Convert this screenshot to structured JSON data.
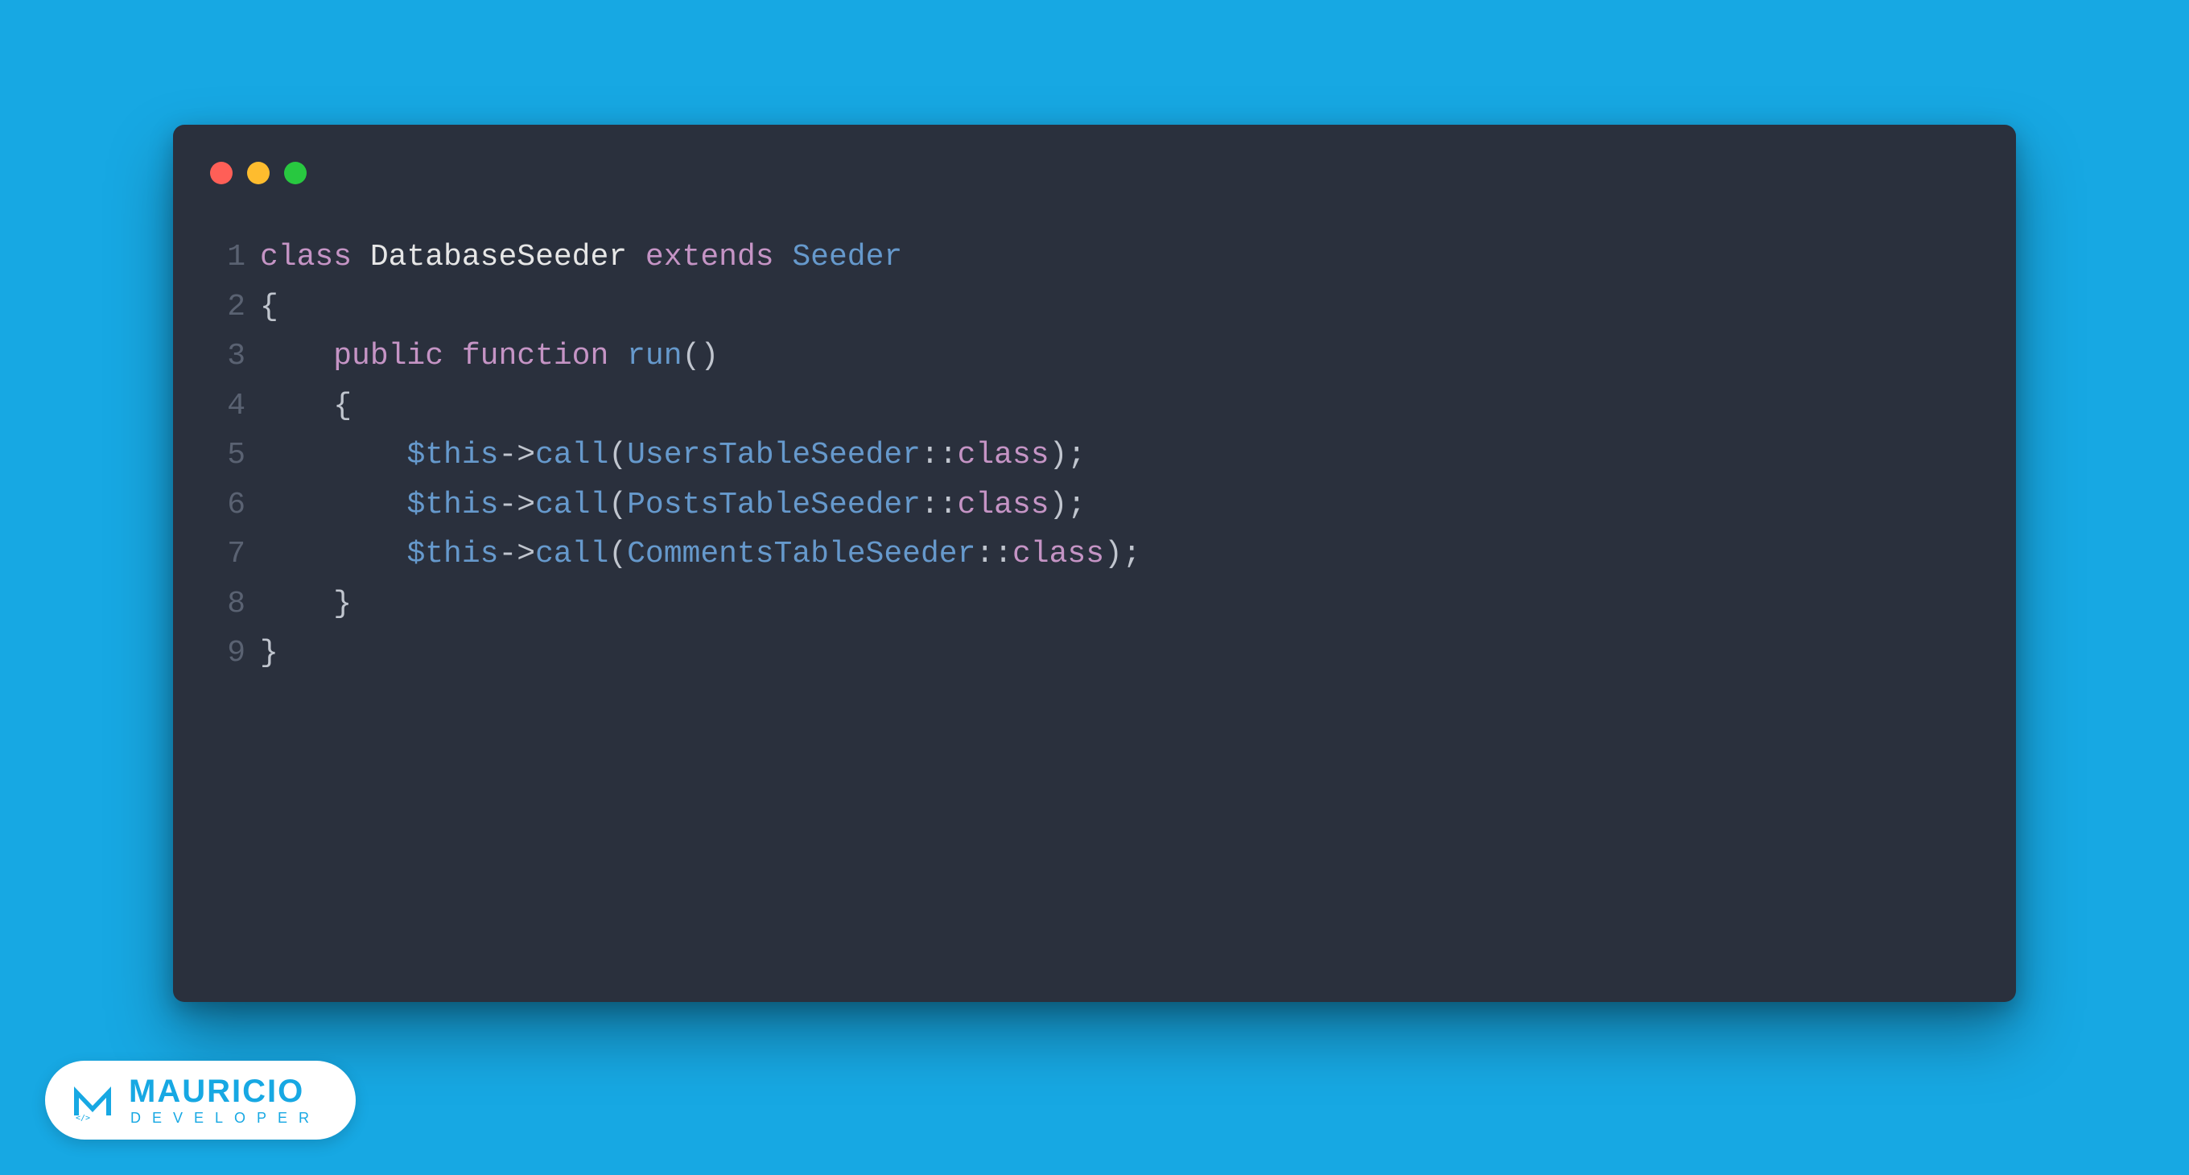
{
  "colors": {
    "background": "#17a8e3",
    "window_bg": "#2a303d",
    "tl_close": "#ff5f57",
    "tl_min": "#febc2e",
    "tl_max": "#28c840",
    "line_number": "#5a6272",
    "keyword": "#c594c5",
    "classname": "#e6e6e6",
    "punc": "#c0c5ce",
    "method": "#6699cc"
  },
  "code": {
    "language": "php",
    "lines": [
      {
        "n": "1",
        "tokens": [
          {
            "t": "class",
            "c": "tok-keyword"
          },
          {
            "t": " ",
            "c": "tok-punc"
          },
          {
            "t": "DatabaseSeeder",
            "c": "tok-classname"
          },
          {
            "t": " ",
            "c": "tok-punc"
          },
          {
            "t": "extends",
            "c": "tok-keyword"
          },
          {
            "t": " ",
            "c": "tok-punc"
          },
          {
            "t": "Seeder",
            "c": "tok-method"
          }
        ]
      },
      {
        "n": "2",
        "tokens": [
          {
            "t": "{",
            "c": "tok-punc"
          }
        ]
      },
      {
        "n": "3",
        "tokens": [
          {
            "t": "    ",
            "c": "tok-punc"
          },
          {
            "t": "public",
            "c": "tok-keyword"
          },
          {
            "t": " ",
            "c": "tok-punc"
          },
          {
            "t": "function",
            "c": "tok-keyword"
          },
          {
            "t": " ",
            "c": "tok-punc"
          },
          {
            "t": "run",
            "c": "tok-method"
          },
          {
            "t": "()",
            "c": "tok-punc"
          }
        ]
      },
      {
        "n": "4",
        "tokens": [
          {
            "t": "    {",
            "c": "tok-punc"
          }
        ]
      },
      {
        "n": "5",
        "tokens": [
          {
            "t": "        ",
            "c": "tok-punc"
          },
          {
            "t": "$this",
            "c": "tok-var"
          },
          {
            "t": "->",
            "c": "tok-arrow"
          },
          {
            "t": "call",
            "c": "tok-method"
          },
          {
            "t": "(",
            "c": "tok-punc"
          },
          {
            "t": "UsersTableSeeder",
            "c": "tok-method"
          },
          {
            "t": "::",
            "c": "tok-scope"
          },
          {
            "t": "class",
            "c": "tok-classkw"
          },
          {
            "t": ");",
            "c": "tok-punc"
          }
        ]
      },
      {
        "n": "6",
        "tokens": [
          {
            "t": "        ",
            "c": "tok-punc"
          },
          {
            "t": "$this",
            "c": "tok-var"
          },
          {
            "t": "->",
            "c": "tok-arrow"
          },
          {
            "t": "call",
            "c": "tok-method"
          },
          {
            "t": "(",
            "c": "tok-punc"
          },
          {
            "t": "PostsTableSeeder",
            "c": "tok-method"
          },
          {
            "t": "::",
            "c": "tok-scope"
          },
          {
            "t": "class",
            "c": "tok-classkw"
          },
          {
            "t": ");",
            "c": "tok-punc"
          }
        ]
      },
      {
        "n": "7",
        "tokens": [
          {
            "t": "        ",
            "c": "tok-punc"
          },
          {
            "t": "$this",
            "c": "tok-var"
          },
          {
            "t": "->",
            "c": "tok-arrow"
          },
          {
            "t": "call",
            "c": "tok-method"
          },
          {
            "t": "(",
            "c": "tok-punc"
          },
          {
            "t": "CommentsTableSeeder",
            "c": "tok-method"
          },
          {
            "t": "::",
            "c": "tok-scope"
          },
          {
            "t": "class",
            "c": "tok-classkw"
          },
          {
            "t": ");",
            "c": "tok-punc"
          }
        ]
      },
      {
        "n": "8",
        "tokens": [
          {
            "t": "    }",
            "c": "tok-punc"
          }
        ]
      },
      {
        "n": "9",
        "tokens": [
          {
            "t": "}",
            "c": "tok-punc"
          }
        ]
      }
    ]
  },
  "logo": {
    "title": "MAURICIO",
    "subtitle": "DEVELOPER"
  }
}
